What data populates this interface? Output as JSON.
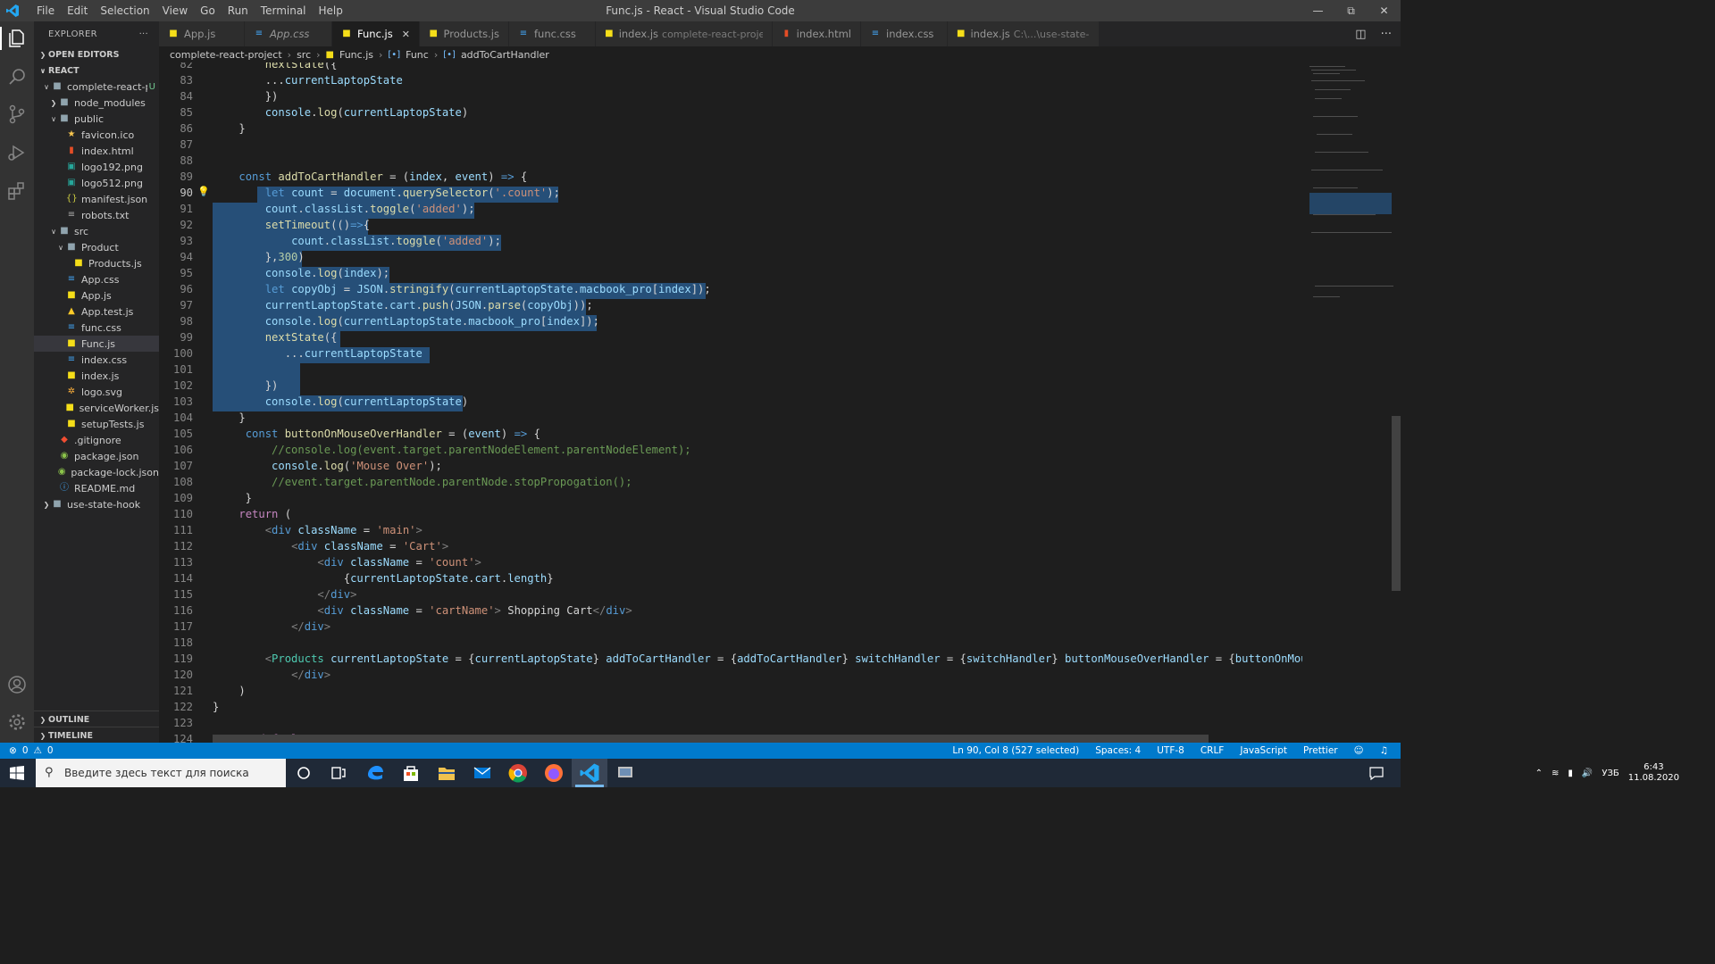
{
  "window": {
    "title": "Func.js - React - Visual Studio Code",
    "menu": [
      "File",
      "Edit",
      "Selection",
      "View",
      "Go",
      "Run",
      "Terminal",
      "Help"
    ]
  },
  "sidebar": {
    "header": "EXPLORER",
    "open_editors": "OPEN EDITORS",
    "project": "REACT",
    "items": [
      {
        "label": "complete-react-p",
        "depth": 1,
        "kind": "folder-open",
        "badge": "U"
      },
      {
        "label": "node_modules",
        "depth": 2,
        "kind": "folder"
      },
      {
        "label": "public",
        "depth": 2,
        "kind": "folder-open"
      },
      {
        "label": "favicon.ico",
        "depth": 3,
        "kind": "star"
      },
      {
        "label": "index.html",
        "depth": 3,
        "kind": "html"
      },
      {
        "label": "logo192.png",
        "depth": 3,
        "kind": "img"
      },
      {
        "label": "logo512.png",
        "depth": 3,
        "kind": "img"
      },
      {
        "label": "manifest.json",
        "depth": 3,
        "kind": "json"
      },
      {
        "label": "robots.txt",
        "depth": 3,
        "kind": "txt"
      },
      {
        "label": "src",
        "depth": 2,
        "kind": "folder-open"
      },
      {
        "label": "Product",
        "depth": 3,
        "kind": "folder-open"
      },
      {
        "label": "Products.js",
        "depth": 4,
        "kind": "js"
      },
      {
        "label": "App.css",
        "depth": 3,
        "kind": "css"
      },
      {
        "label": "App.js",
        "depth": 3,
        "kind": "js"
      },
      {
        "label": "App.test.js",
        "depth": 3,
        "kind": "test"
      },
      {
        "label": "func.css",
        "depth": 3,
        "kind": "css"
      },
      {
        "label": "Func.js",
        "depth": 3,
        "kind": "js",
        "active": true
      },
      {
        "label": "index.css",
        "depth": 3,
        "kind": "css"
      },
      {
        "label": "index.js",
        "depth": 3,
        "kind": "js"
      },
      {
        "label": "logo.svg",
        "depth": 3,
        "kind": "svg"
      },
      {
        "label": "serviceWorker.js",
        "depth": 3,
        "kind": "js"
      },
      {
        "label": "setupTests.js",
        "depth": 3,
        "kind": "js"
      },
      {
        "label": ".gitignore",
        "depth": 2,
        "kind": "git"
      },
      {
        "label": "package.json",
        "depth": 2,
        "kind": "json2"
      },
      {
        "label": "package-lock.json",
        "depth": 2,
        "kind": "json2"
      },
      {
        "label": "README.md",
        "depth": 2,
        "kind": "info"
      },
      {
        "label": "use-state-hook",
        "depth": 1,
        "kind": "folder"
      }
    ],
    "outline": "OUTLINE",
    "timeline": "TIMELINE"
  },
  "tabs": [
    {
      "label": "App.js",
      "kind": "js"
    },
    {
      "label": "App.css",
      "kind": "css",
      "italic": true
    },
    {
      "label": "Func.js",
      "kind": "js",
      "active": true
    },
    {
      "label": "Products.js",
      "kind": "js"
    },
    {
      "label": "func.css",
      "kind": "css"
    },
    {
      "label": "index.js",
      "kind": "js",
      "sub": "complete-react-project\\..."
    },
    {
      "label": "index.html",
      "kind": "html"
    },
    {
      "label": "index.css",
      "kind": "css"
    },
    {
      "label": "index.js",
      "kind": "js",
      "sub": "C:\\...\\use-state-hook\\..."
    }
  ],
  "breadcrumbs": [
    "complete-react-project",
    "src",
    "Func.js",
    "Func",
    "addToCartHandler"
  ],
  "code": {
    "lines": [
      {
        "n": "82",
        "html": "        <span class='fn'>nextState</span>({"
      },
      {
        "n": "83",
        "html": "        ...<span class='vr'>currentLaptopState</span>"
      },
      {
        "n": "84",
        "html": "        })"
      },
      {
        "n": "85",
        "html": "        <span class='vr'>console</span>.<span class='fn'>log</span>(<span class='vr'>currentLaptopState</span>)"
      },
      {
        "n": "86",
        "html": "    }"
      },
      {
        "n": "87",
        "html": ""
      },
      {
        "n": "88",
        "html": ""
      },
      {
        "n": "89",
        "html": "    <span class='kw'>const</span> <span class='fn'>addToCartHandler</span> = (<span class='vr'>index</span>, <span class='vr'>event</span>) <span class='kw'>=&gt;</span> {"
      },
      {
        "n": "90",
        "html": "        <span class='kw'>let</span> <span class='vr'>count</span> = <span class='vr'>document</span>.<span class='fn'>querySelector</span>(<span class='st'>'.count'</span>);"
      },
      {
        "n": "91",
        "html": "        <span class='vr'>count</span>.<span class='vr'>classList</span>.<span class='fn'>toggle</span>(<span class='st'>'added'</span>);"
      },
      {
        "n": "92",
        "html": "        <span class='fn'>setTimeout</span>(()<span class='kw'>=&gt;</span>{"
      },
      {
        "n": "93",
        "html": "            <span class='vr'>count</span>.<span class='vr'>classList</span>.<span class='fn'>toggle</span>(<span class='st'>'added'</span>);"
      },
      {
        "n": "94",
        "html": "        },<span class='nm'>300</span>)"
      },
      {
        "n": "95",
        "html": "        <span class='vr'>console</span>.<span class='fn'>log</span>(<span class='vr'>index</span>);"
      },
      {
        "n": "96",
        "html": "        <span class='kw'>let</span> <span class='vr'>copyObj</span> = <span class='vr'>JSON</span>.<span class='fn'>stringify</span>(<span class='vr'>currentLaptopState</span>.<span class='vr'>macbook_pro</span>[<span class='vr'>index</span>]);"
      },
      {
        "n": "97",
        "html": "        <span class='vr'>currentLaptopState</span>.<span class='vr'>cart</span>.<span class='fn'>push</span>(<span class='vr'>JSON</span>.<span class='fn'>parse</span>(<span class='vr'>copyObj</span>));"
      },
      {
        "n": "98",
        "html": "        <span class='vr'>console</span>.<span class='fn'>log</span>(<span class='vr'>currentLaptopState</span>.<span class='vr'>macbook_pro</span>[<span class='vr'>index</span>]);"
      },
      {
        "n": "99",
        "html": "        <span class='fn'>nextState</span>({"
      },
      {
        "n": "100",
        "html": "           ...<span class='vr'>currentLaptopState</span>"
      },
      {
        "n": "101",
        "html": ""
      },
      {
        "n": "102",
        "html": "        })"
      },
      {
        "n": "103",
        "html": "        <span class='vr'>console</span>.<span class='fn'>log</span>(<span class='vr'>currentLaptopState</span>)"
      },
      {
        "n": "104",
        "html": "    }"
      },
      {
        "n": "105",
        "html": "     <span class='kw'>const</span> <span class='fn'>buttonOnMouseOverHandler</span> = (<span class='vr'>event</span>) <span class='kw'>=&gt;</span> {"
      },
      {
        "n": "106",
        "html": "         <span class='cm'>//console.log(event.target.parentNodeElement.parentNodeElement);</span>"
      },
      {
        "n": "107",
        "html": "         <span class='vr'>console</span>.<span class='fn'>log</span>(<span class='st'>'Mouse Over'</span>);"
      },
      {
        "n": "108",
        "html": "         <span class='cm'>//event.target.parentNode.parentNode.stopPropogation();</span>"
      },
      {
        "n": "109",
        "html": "     }"
      },
      {
        "n": "110",
        "html": "    <span class='pk'>return</span> ("
      },
      {
        "n": "111",
        "html": "        <span class='tgb'>&lt;</span><span class='kw'>div</span> <span class='vr'>className</span> = <span class='st'>'main'</span><span class='tgb'>&gt;</span>"
      },
      {
        "n": "112",
        "html": "            <span class='tgb'>&lt;</span><span class='kw'>div</span> <span class='vr'>className</span> = <span class='st'>'Cart'</span><span class='tgb'>&gt;</span>"
      },
      {
        "n": "113",
        "html": "                <span class='tgb'>&lt;</span><span class='kw'>div</span> <span class='vr'>className</span> = <span class='st'>'count'</span><span class='tgb'>&gt;</span>"
      },
      {
        "n": "114",
        "html": "                    {<span class='vr'>currentLaptopState</span>.<span class='vr'>cart</span>.<span class='vr'>length</span>}"
      },
      {
        "n": "115",
        "html": "                <span class='tgb'>&lt;/</span><span class='kw'>div</span><span class='tgb'>&gt;</span>"
      },
      {
        "n": "116",
        "html": "                <span class='tgb'>&lt;</span><span class='kw'>div</span> <span class='vr'>className</span> = <span class='st'>'cartName'</span><span class='tgb'>&gt;</span> Shopping Cart<span class='tgb'>&lt;/</span><span class='kw'>div</span><span class='tgb'>&gt;</span>"
      },
      {
        "n": "117",
        "html": "            <span class='tgb'>&lt;/</span><span class='kw'>div</span><span class='tgb'>&gt;</span>"
      },
      {
        "n": "118",
        "html": ""
      },
      {
        "n": "119",
        "html": "        <span class='tgb'>&lt;</span><span class='tg'>Products</span> <span class='vr'>currentLaptopState</span> = {<span class='vr'>currentLaptopState</span>} <span class='vr'>addToCartHandler</span> = {<span class='vr'>addToCartHandler</span>} <span class='vr'>switchHandler</span> = {<span class='vr'>switchHandler</span>} <span class='vr'>buttonMouseOverHandler</span> = {<span class='vr'>buttonOnMouseO</span>"
      },
      {
        "n": "120",
        "html": "            <span class='tgb'>&lt;/</span><span class='kw'>div</span><span class='tgb'>&gt;</span>"
      },
      {
        "n": "121",
        "html": "    )"
      },
      {
        "n": "122",
        "html": "}"
      },
      {
        "n": "123",
        "html": ""
      },
      {
        "n": "124",
        "html": "<span class='pk'>export</span> <span class='pk'>default</span> <span class='vr'>Func</span>;"
      }
    ]
  },
  "status": {
    "errors": "0",
    "warnings": "0",
    "position": "Ln 90, Col 8 (527 selected)",
    "spaces": "Spaces: 4",
    "encoding": "UTF-8",
    "eol": "CRLF",
    "language": "JavaScript",
    "formatter": "Prettier"
  },
  "taskbar": {
    "search_placeholder": "Введите здесь текст для поиска",
    "lang": "УЗБ",
    "time": "6:43",
    "date": "11.08.2020"
  }
}
